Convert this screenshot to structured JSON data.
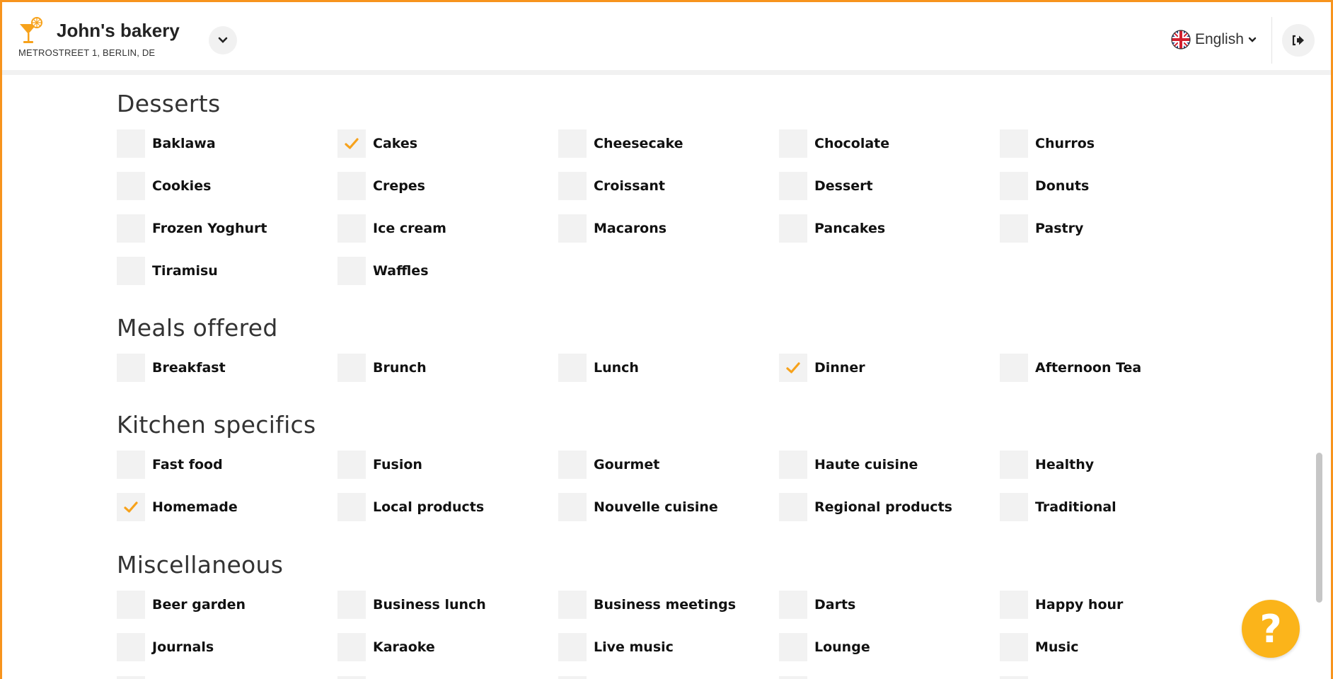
{
  "header": {
    "title": "John's bakery",
    "address": "METROSTREET 1, BERLIN, DE",
    "language": "English",
    "logo_icon": "cocktail-icon",
    "accent_color": "#f7941d"
  },
  "help": {
    "label": "?"
  },
  "sections": [
    {
      "title": "Desserts",
      "options": [
        {
          "label": "Baklawa",
          "checked": false
        },
        {
          "label": "Cakes",
          "checked": true
        },
        {
          "label": "Cheesecake",
          "checked": false
        },
        {
          "label": "Chocolate",
          "checked": false
        },
        {
          "label": "Churros",
          "checked": false
        },
        {
          "label": "Cookies",
          "checked": false
        },
        {
          "label": "Crepes",
          "checked": false
        },
        {
          "label": "Croissant",
          "checked": false
        },
        {
          "label": "Dessert",
          "checked": false
        },
        {
          "label": "Donuts",
          "checked": false
        },
        {
          "label": "Frozen Yoghurt",
          "checked": false
        },
        {
          "label": "Ice cream",
          "checked": false
        },
        {
          "label": "Macarons",
          "checked": false
        },
        {
          "label": "Pancakes",
          "checked": false
        },
        {
          "label": "Pastry",
          "checked": false
        },
        {
          "label": "Tiramisu",
          "checked": false
        },
        {
          "label": "Waffles",
          "checked": false
        }
      ]
    },
    {
      "title": "Meals offered",
      "options": [
        {
          "label": "Breakfast",
          "checked": false
        },
        {
          "label": "Brunch",
          "checked": false
        },
        {
          "label": "Lunch",
          "checked": false
        },
        {
          "label": "Dinner",
          "checked": true
        },
        {
          "label": "Afternoon Tea",
          "checked": false
        }
      ]
    },
    {
      "title": "Kitchen specifics",
      "options": [
        {
          "label": "Fast food",
          "checked": false
        },
        {
          "label": "Fusion",
          "checked": false
        },
        {
          "label": "Gourmet",
          "checked": false
        },
        {
          "label": "Haute cuisine",
          "checked": false
        },
        {
          "label": "Healthy",
          "checked": false
        },
        {
          "label": "Homemade",
          "checked": true
        },
        {
          "label": "Local products",
          "checked": false
        },
        {
          "label": "Nouvelle cuisine",
          "checked": false
        },
        {
          "label": "Regional products",
          "checked": false
        },
        {
          "label": "Traditional",
          "checked": false
        }
      ]
    },
    {
      "title": "Miscellaneous",
      "options": [
        {
          "label": "Beer garden",
          "checked": false
        },
        {
          "label": "Business lunch",
          "checked": false
        },
        {
          "label": "Business meetings",
          "checked": false
        },
        {
          "label": "Darts",
          "checked": false
        },
        {
          "label": "Happy hour",
          "checked": false
        },
        {
          "label": "Journals",
          "checked": false
        },
        {
          "label": "Karaoke",
          "checked": false
        },
        {
          "label": "Live music",
          "checked": false
        },
        {
          "label": "Lounge",
          "checked": false
        },
        {
          "label": "Music",
          "checked": false
        }
      ]
    }
  ]
}
